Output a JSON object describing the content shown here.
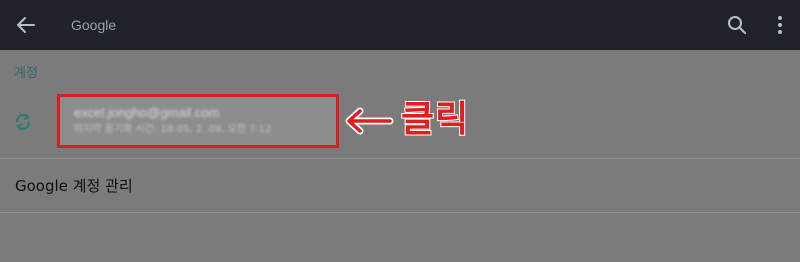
{
  "appbar": {
    "title": "Google",
    "back_icon": "arrow-left-icon",
    "search_icon": "search-icon",
    "more_icon": "more-vert-icon"
  },
  "accounts_section": {
    "header": "계정",
    "sync_icon": "sync-icon",
    "account": {
      "email": "excel.jongho@gmail.com",
      "status": "마지막 동기화 시간: 18:05, 2. 09, 오전 7:12"
    }
  },
  "annotation": {
    "arrow_icon": "arrow-left-icon",
    "label": "클릭",
    "color": "#e01e1e"
  },
  "manage_item": {
    "label": "Google 계정 관리"
  },
  "colors": {
    "appbar_bg": "#1f2329",
    "content_bg": "#7b7b7b",
    "accent_teal": "#2b6d6a",
    "highlight_red": "#d81f1f"
  }
}
